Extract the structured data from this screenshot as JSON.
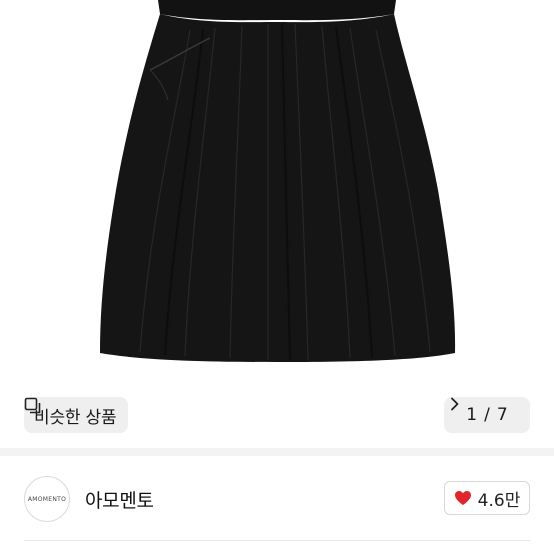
{
  "product": {
    "image_subject": "black gathered midi skirt"
  },
  "similar": {
    "label": "비슷한 상품",
    "icon": "similar-products-icon"
  },
  "pager": {
    "current": "1",
    "separator": "/",
    "total": "7",
    "icon": "chevron-right-icon"
  },
  "shop": {
    "logo_text": "AMOMENTO",
    "name": "아모멘토"
  },
  "likes": {
    "count": "4.6만",
    "icon": "heart-icon",
    "heart_color": "#e0262d"
  },
  "colors": {
    "skirt": "#151515",
    "chip_bg": "#efefef",
    "divider": "#f3f3f3"
  }
}
